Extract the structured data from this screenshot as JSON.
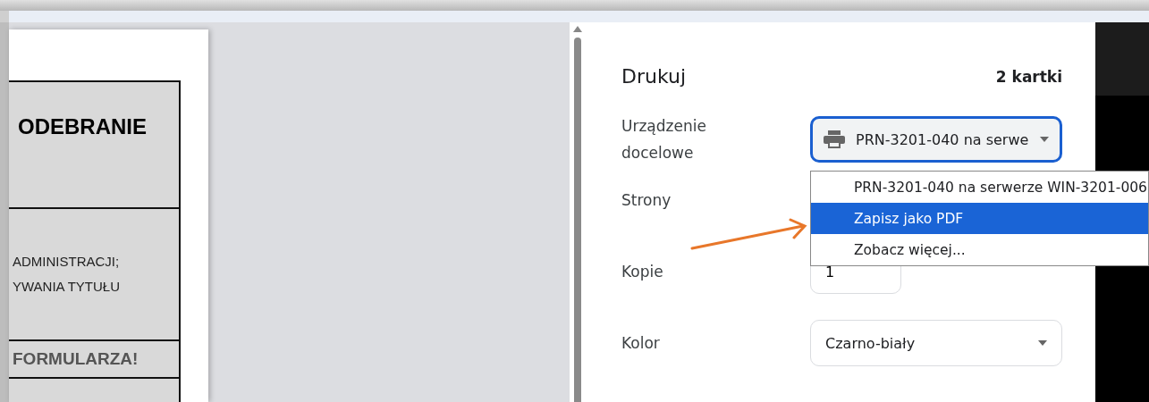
{
  "document_preview": {
    "table_rows": [
      {
        "kind": "heading",
        "lines": [
          "ODEBRANIE"
        ]
      },
      {
        "kind": "body",
        "lines": [
          "ADMINISTRACJI;",
          "YWANIA TYTUŁU"
        ]
      },
      {
        "kind": "warning",
        "lines": [
          "FORMULARZA!"
        ]
      },
      {
        "kind": "empty"
      }
    ]
  },
  "print_panel": {
    "title": "Drukuj",
    "sheets": "2 kartki",
    "settings": [
      {
        "label": "Urządzenie docelowe",
        "kind": "printer-select",
        "value": "PRN-3201-040 na serwe",
        "focused": true
      },
      {
        "label": "Strony",
        "kind": "covered"
      },
      {
        "label": "Kopie",
        "kind": "number",
        "value": "1"
      },
      {
        "label": "Kolor",
        "kind": "select",
        "value": "Czarno-biały",
        "focused": false
      }
    ]
  },
  "destination_menu": {
    "options": [
      {
        "label": "PRN-3201-040 na serwerze WIN-3201-006",
        "selected": false
      },
      {
        "label": "Zapisz jako PDF",
        "selected": true
      },
      {
        "label": "Zobacz więcej...",
        "selected": false
      }
    ]
  }
}
